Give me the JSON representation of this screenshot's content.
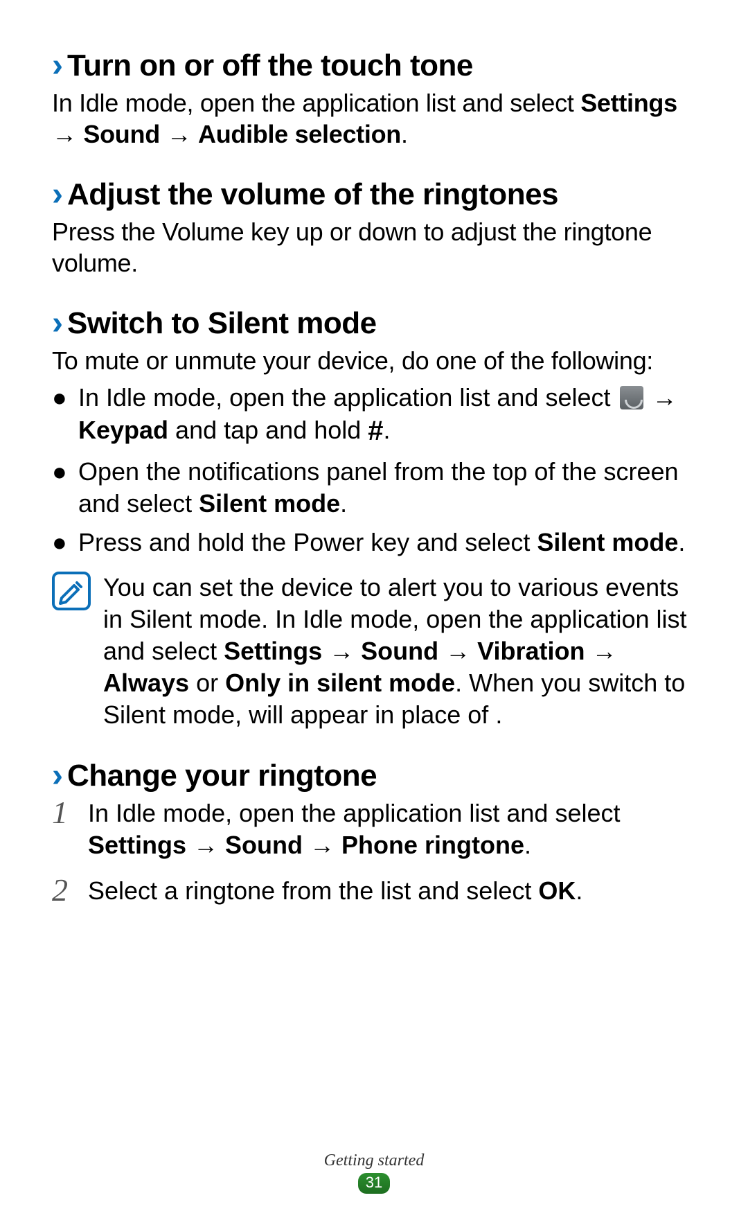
{
  "sections": {
    "touchTone": {
      "title": "Turn on or off the touch tone",
      "body_pre": "In Idle mode, open the application list and select ",
      "body_b1": "Settings",
      "body_arrow1": " → ",
      "body_b2": "Sound",
      "body_arrow2": " → ",
      "body_b3": "Audible selection",
      "body_post": "."
    },
    "volume": {
      "title": "Adjust the volume of the ringtones",
      "body": "Press the Volume key up or down to adjust the ringtone volume."
    },
    "silent": {
      "title": "Switch to Silent mode",
      "intro": "To mute or unmute your device, do one of the following:",
      "bullet1_pre": "In Idle mode, open the application list and select ",
      "bullet1_arrow": " → ",
      "bullet1_b1": "Keypad",
      "bullet1_mid": " and tap and hold ",
      "bullet1_hash": "#",
      "bullet1_post": ".",
      "bullet2_pre": "Open the notifications panel from the top of the screen and select ",
      "bullet2_b1": "Silent mode",
      "bullet2_post": ".",
      "bullet3_pre": "Press and hold the Power key and select ",
      "bullet3_b1": "Silent mode",
      "bullet3_post": ".",
      "note_pre": "You can set the device to alert you to various events in Silent mode. In Idle mode, open the application list and select ",
      "note_b1": "Settings",
      "note_a1": " → ",
      "note_b2": "Sound",
      "note_a2": " → ",
      "note_b3": "Vibration",
      "note_a3": " → ",
      "note_b4": "Always",
      "note_or": " or ",
      "note_b5": "Only in silent mode",
      "note_mid": ". When you switch to Silent mode,      will appear in place of      ."
    },
    "ringtone": {
      "title": "Change your ringtone",
      "step1_num": "1",
      "step1_pre": "In Idle mode, open the application list and select ",
      "step1_b1": "Settings",
      "step1_a1": " → ",
      "step1_b2": "Sound",
      "step1_a2": " → ",
      "step1_b3": "Phone ringtone",
      "step1_post": ".",
      "step2_num": "2",
      "step2_pre": "Select a ringtone from the list and select ",
      "step2_b1": "OK",
      "step2_post": "."
    }
  },
  "footer": {
    "section": "Getting started",
    "page": "31"
  }
}
